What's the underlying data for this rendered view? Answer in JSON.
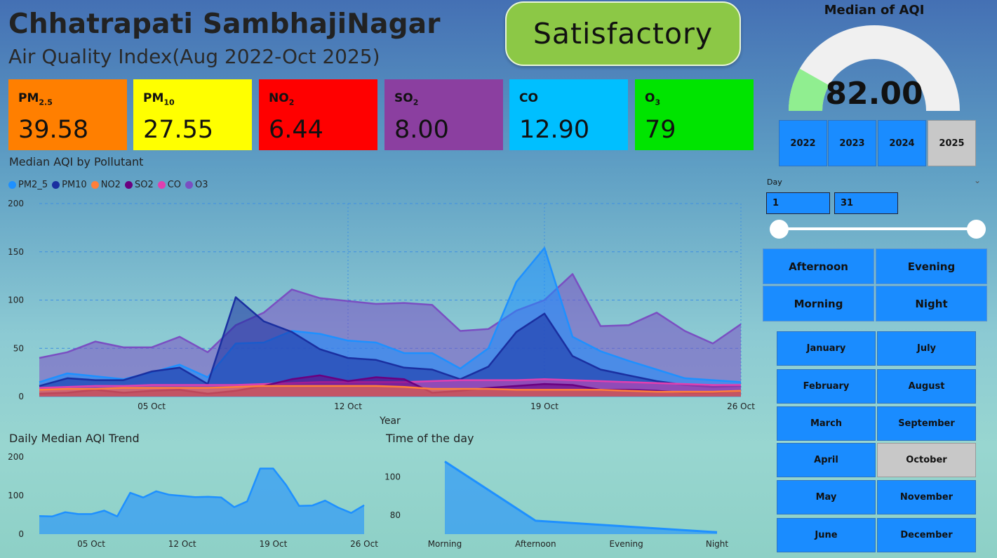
{
  "header": {
    "title": "Chhatrapati SambhajiNagar",
    "subtitle": "Air Quality Index(Aug 2022-Oct 2025)",
    "status": "Satisfactory"
  },
  "kpis": [
    {
      "label": "PM",
      "sub": "2.5",
      "value": "39.58",
      "color": "#ff7f00"
    },
    {
      "label": "PM",
      "sub": "10",
      "value": "27.55",
      "color": "#ffff00"
    },
    {
      "label": "NO",
      "sub": "2",
      "value": "6.44",
      "color": "#ff0000"
    },
    {
      "label": "SO",
      "sub": "2",
      "value": "8.00",
      "color": "#8b3fa0"
    },
    {
      "label": "CO",
      "sub": "",
      "value": "12.90",
      "color": "#00bfff"
    },
    {
      "label": "O",
      "sub": "3",
      "value": "79",
      "color": "#00e400"
    }
  ],
  "gauge": {
    "title": "Median of AQI",
    "value_text": "82.00",
    "value": 82,
    "min": 0,
    "max": 500,
    "fill_color": "#90ee90",
    "track_color": "#f0f0f0"
  },
  "years": {
    "items": [
      "2022",
      "2023",
      "2024",
      "2025"
    ],
    "selected": "2025"
  },
  "day_filter": {
    "label": "Day",
    "from": "1",
    "to": "31"
  },
  "time_of_day_buttons": [
    "Afternoon",
    "Evening",
    "Morning",
    "Night"
  ],
  "months": {
    "left": [
      "January",
      "February",
      "March",
      "April",
      "May",
      "June"
    ],
    "right": [
      "July",
      "August",
      "September",
      "October",
      "November",
      "December"
    ],
    "selected": "October"
  },
  "main_chart_title": "Median AQI by Pollutant",
  "daily_chart_title": "Daily Median AQI Trend",
  "tod_chart_title": "Time of the day",
  "chart_data": [
    {
      "type": "area",
      "title": "Median AQI by Pollutant",
      "xlabel": "Year",
      "ylabel": "",
      "ylim": [
        0,
        200
      ],
      "yticks": [
        0,
        50,
        100,
        150,
        200
      ],
      "x": [
        1,
        2,
        3,
        4,
        5,
        6,
        7,
        8,
        9,
        10,
        11,
        12,
        13,
        14,
        15,
        16,
        17,
        18,
        19,
        20,
        21,
        22,
        23,
        24,
        25,
        26
      ],
      "xticks": [
        {
          "x": 5,
          "label": "05 Oct"
        },
        {
          "x": 12,
          "label": "12 Oct"
        },
        {
          "x": 19,
          "label": "19 Oct"
        },
        {
          "x": 26,
          "label": "26 Oct"
        }
      ],
      "grid": true,
      "legend": "top-left",
      "series": [
        {
          "name": "O3",
          "color": "#7a4fc2",
          "values": [
            40,
            46,
            57,
            51,
            51,
            62,
            46,
            74,
            87,
            111,
            102,
            99,
            96,
            97,
            95,
            68,
            70,
            89,
            100,
            127,
            73,
            74,
            87,
            68,
            55,
            75
          ]
        },
        {
          "name": "PM2_5",
          "color": "#1e90ff",
          "values": [
            15,
            24,
            21,
            18,
            25,
            33,
            20,
            55,
            56,
            68,
            65,
            58,
            56,
            45,
            45,
            29,
            50,
            119,
            154,
            62,
            47,
            37,
            28,
            19,
            17,
            15
          ]
        },
        {
          "name": "PM10",
          "color": "#1a2fa0",
          "values": [
            11,
            19,
            17,
            17,
            26,
            30,
            13,
            103,
            78,
            67,
            49,
            40,
            38,
            30,
            28,
            18,
            31,
            67,
            86,
            42,
            28,
            22,
            16,
            12,
            10,
            11
          ]
        },
        {
          "name": "CO",
          "color": "#e040b0",
          "values": [
            9,
            10,
            11,
            11,
            12,
            12,
            12,
            12,
            13,
            14,
            15,
            15,
            15,
            15,
            16,
            17,
            17,
            17,
            18,
            17,
            16,
            15,
            14,
            13,
            12,
            12
          ]
        },
        {
          "name": "SO2",
          "color": "#6a0080",
          "values": [
            3,
            4,
            7,
            4,
            6,
            7,
            3,
            6,
            11,
            18,
            22,
            16,
            20,
            18,
            4,
            6,
            9,
            11,
            13,
            12,
            7,
            7,
            6,
            4,
            4,
            6
          ]
        },
        {
          "name": "NO2",
          "color": "#ff7f3a",
          "values": [
            7,
            8,
            8,
            9,
            9,
            9,
            9,
            10,
            11,
            11,
            11,
            11,
            11,
            10,
            8,
            8,
            8,
            7,
            7,
            7,
            7,
            6,
            5,
            5,
            5,
            6
          ]
        }
      ]
    },
    {
      "type": "area",
      "title": "Daily Median AQI Trend",
      "ylim": [
        0,
        200
      ],
      "yticks": [
        0,
        100,
        200
      ],
      "x": [
        1,
        2,
        3,
        4,
        5,
        6,
        7,
        8,
        9,
        10,
        11,
        12,
        13,
        14,
        15,
        16,
        17,
        18,
        19,
        20,
        21,
        22,
        23,
        24,
        25,
        26
      ],
      "xticks": [
        {
          "x": 5,
          "label": "05 Oct"
        },
        {
          "x": 12,
          "label": "12 Oct"
        },
        {
          "x": 19,
          "label": "19 Oct"
        },
        {
          "x": 26,
          "label": "26 Oct"
        }
      ],
      "series": [
        {
          "name": "",
          "color": "#1e90ff",
          "values": [
            47,
            46,
            57,
            52,
            52,
            61,
            46,
            107,
            95,
            111,
            102,
            99,
            96,
            97,
            95,
            70,
            85,
            170,
            170,
            127,
            73,
            74,
            87,
            69,
            55,
            75
          ]
        }
      ]
    },
    {
      "type": "area",
      "title": "Time of the day",
      "categories": [
        "Morning",
        "Afternoon",
        "Evening",
        "Night"
      ],
      "ylim": [
        70,
        110
      ],
      "yticks": [
        80,
        100
      ],
      "series": [
        {
          "name": "",
          "color": "#1e90ff",
          "values": [
            108,
            77,
            74,
            71
          ]
        }
      ]
    }
  ]
}
